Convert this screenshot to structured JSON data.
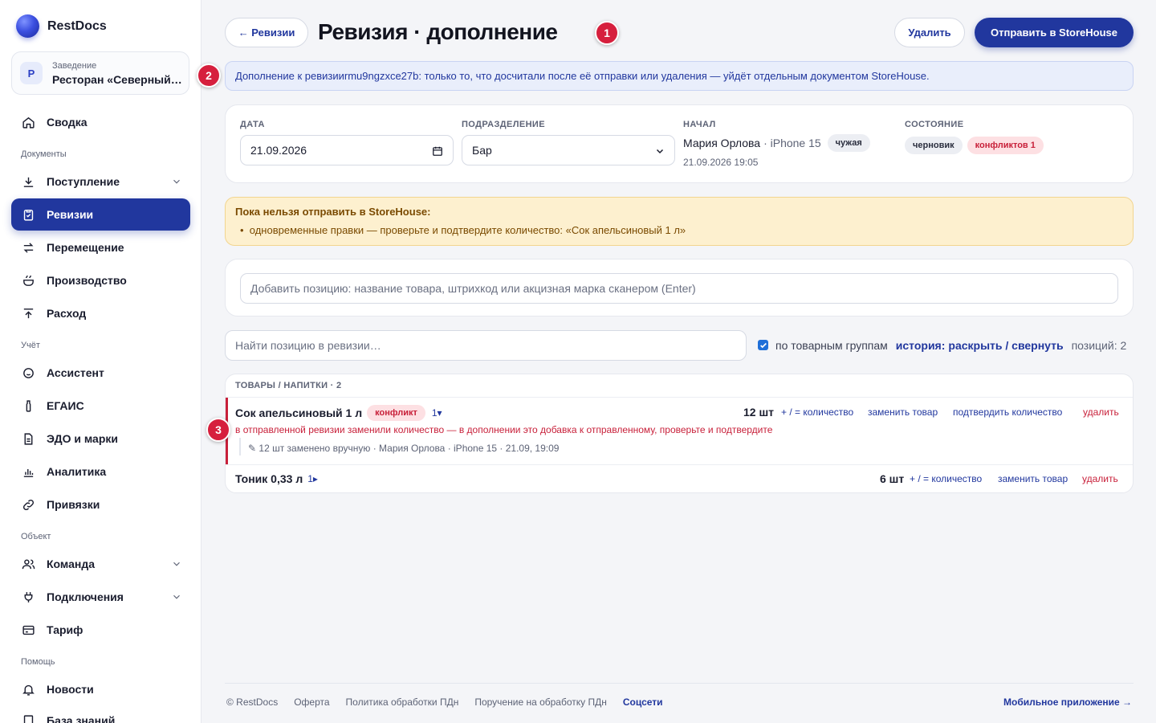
{
  "brand": {
    "name": "RestDocs"
  },
  "venue": {
    "badge": "Р",
    "caption": "Заведение",
    "name": "Ресторан «Северный…"
  },
  "nav": {
    "summary": "Сводка",
    "sec_docs": "Документы",
    "receipt": "Поступление",
    "revisions": "Ревизии",
    "transfer": "Перемещение",
    "production": "Производство",
    "expense": "Расход",
    "sec_account": "Учёт",
    "assistant": "Ассистент",
    "egais": "ЕГАИС",
    "edo": "ЭДО и марки",
    "analytics": "Аналитика",
    "bindings": "Привязки",
    "sec_object": "Объект",
    "team": "Команда",
    "connections": "Подключения",
    "tariff": "Тариф",
    "sec_help": "Помощь",
    "news": "Новости",
    "kb": "База знаний"
  },
  "header": {
    "back": "← Ревизии",
    "title": "Ревизия · дополнение",
    "delete": "Удалить",
    "send": "Отправить в StoreHouse"
  },
  "markers": {
    "m1": "1",
    "m2": "2",
    "m3": "3"
  },
  "info": {
    "text": "Дополнение к ревизии ",
    "id": "rmu9ngzxce27b",
    "rest": ": только то, что досчитали после её отправки или удаления — уйдёт отдельным документом StoreHouse."
  },
  "meta": {
    "date_label": "ДАТА",
    "date_value": "21.09.2026",
    "dept_label": "ПОДРАЗДЕЛЕНИЕ",
    "dept_value": "Бар",
    "start_label": "НАЧАЛ",
    "start_user": "Мария Орлова",
    "start_device": " · iPhone 15",
    "start_tag": "чужая",
    "start_time": "21.09.2026 19:05",
    "state_label": "СОСТОЯНИЕ",
    "state_draft": "черновик",
    "state_conflicts": "конфликтов 1"
  },
  "warning": {
    "title": "Пока нельзя отправить в StoreHouse:",
    "item": "одновременные правки — проверьте и подтвердите количество: «Сок апельсиновый 1 л»"
  },
  "add": {
    "placeholder": "Добавить позицию: название товара, штрихкод или акцизная марка сканером (Enter)"
  },
  "filter": {
    "placeholder": "Найти позицию в ревизии…",
    "group_label": "по товарным группам",
    "history_label": "история:",
    "expand": "раскрыть",
    "sep": " / ",
    "collapse": "свернуть",
    "count": "позиций: 2"
  },
  "group": {
    "header": "ТОВАРЫ / НАПИТКИ · 2",
    "rows": [
      {
        "name": "Сок апельсиновый 1 л",
        "badge": "конфликт",
        "hist": "1▾",
        "qty": "12 шт",
        "act_qty": "+ / = количество",
        "act_replace": "заменить товар",
        "act_confirm": "подтвердить количество",
        "act_delete": "удалить",
        "conflict_note": "в отправленной ревизии заменили количество — в дополнении это добавка к отправленному, проверьте и подтвердите",
        "history": "✎ 12 шт заменено вручную · Мария Орлова · iPhone 15 · 21.09, 19:09"
      },
      {
        "name": "Тоник 0,33 л",
        "hist": "1▸",
        "qty": "6 шт",
        "act_qty": "+ / = количество",
        "act_replace": "заменить товар",
        "act_delete": "удалить"
      }
    ]
  },
  "footer": {
    "copy": "© RestDocs",
    "offer": "Оферта",
    "policy": "Политика обработки ПДн",
    "order": "Поручение на обработку ПДн",
    "social": "Соцсети",
    "mobile": "Мобильное приложение →"
  },
  "colors": {
    "accent": "#21379e",
    "danger": "#c8203a",
    "marker": "#d61f3d",
    "warning_bg": "#fdf0cf",
    "info_bg": "#e9eefb"
  }
}
